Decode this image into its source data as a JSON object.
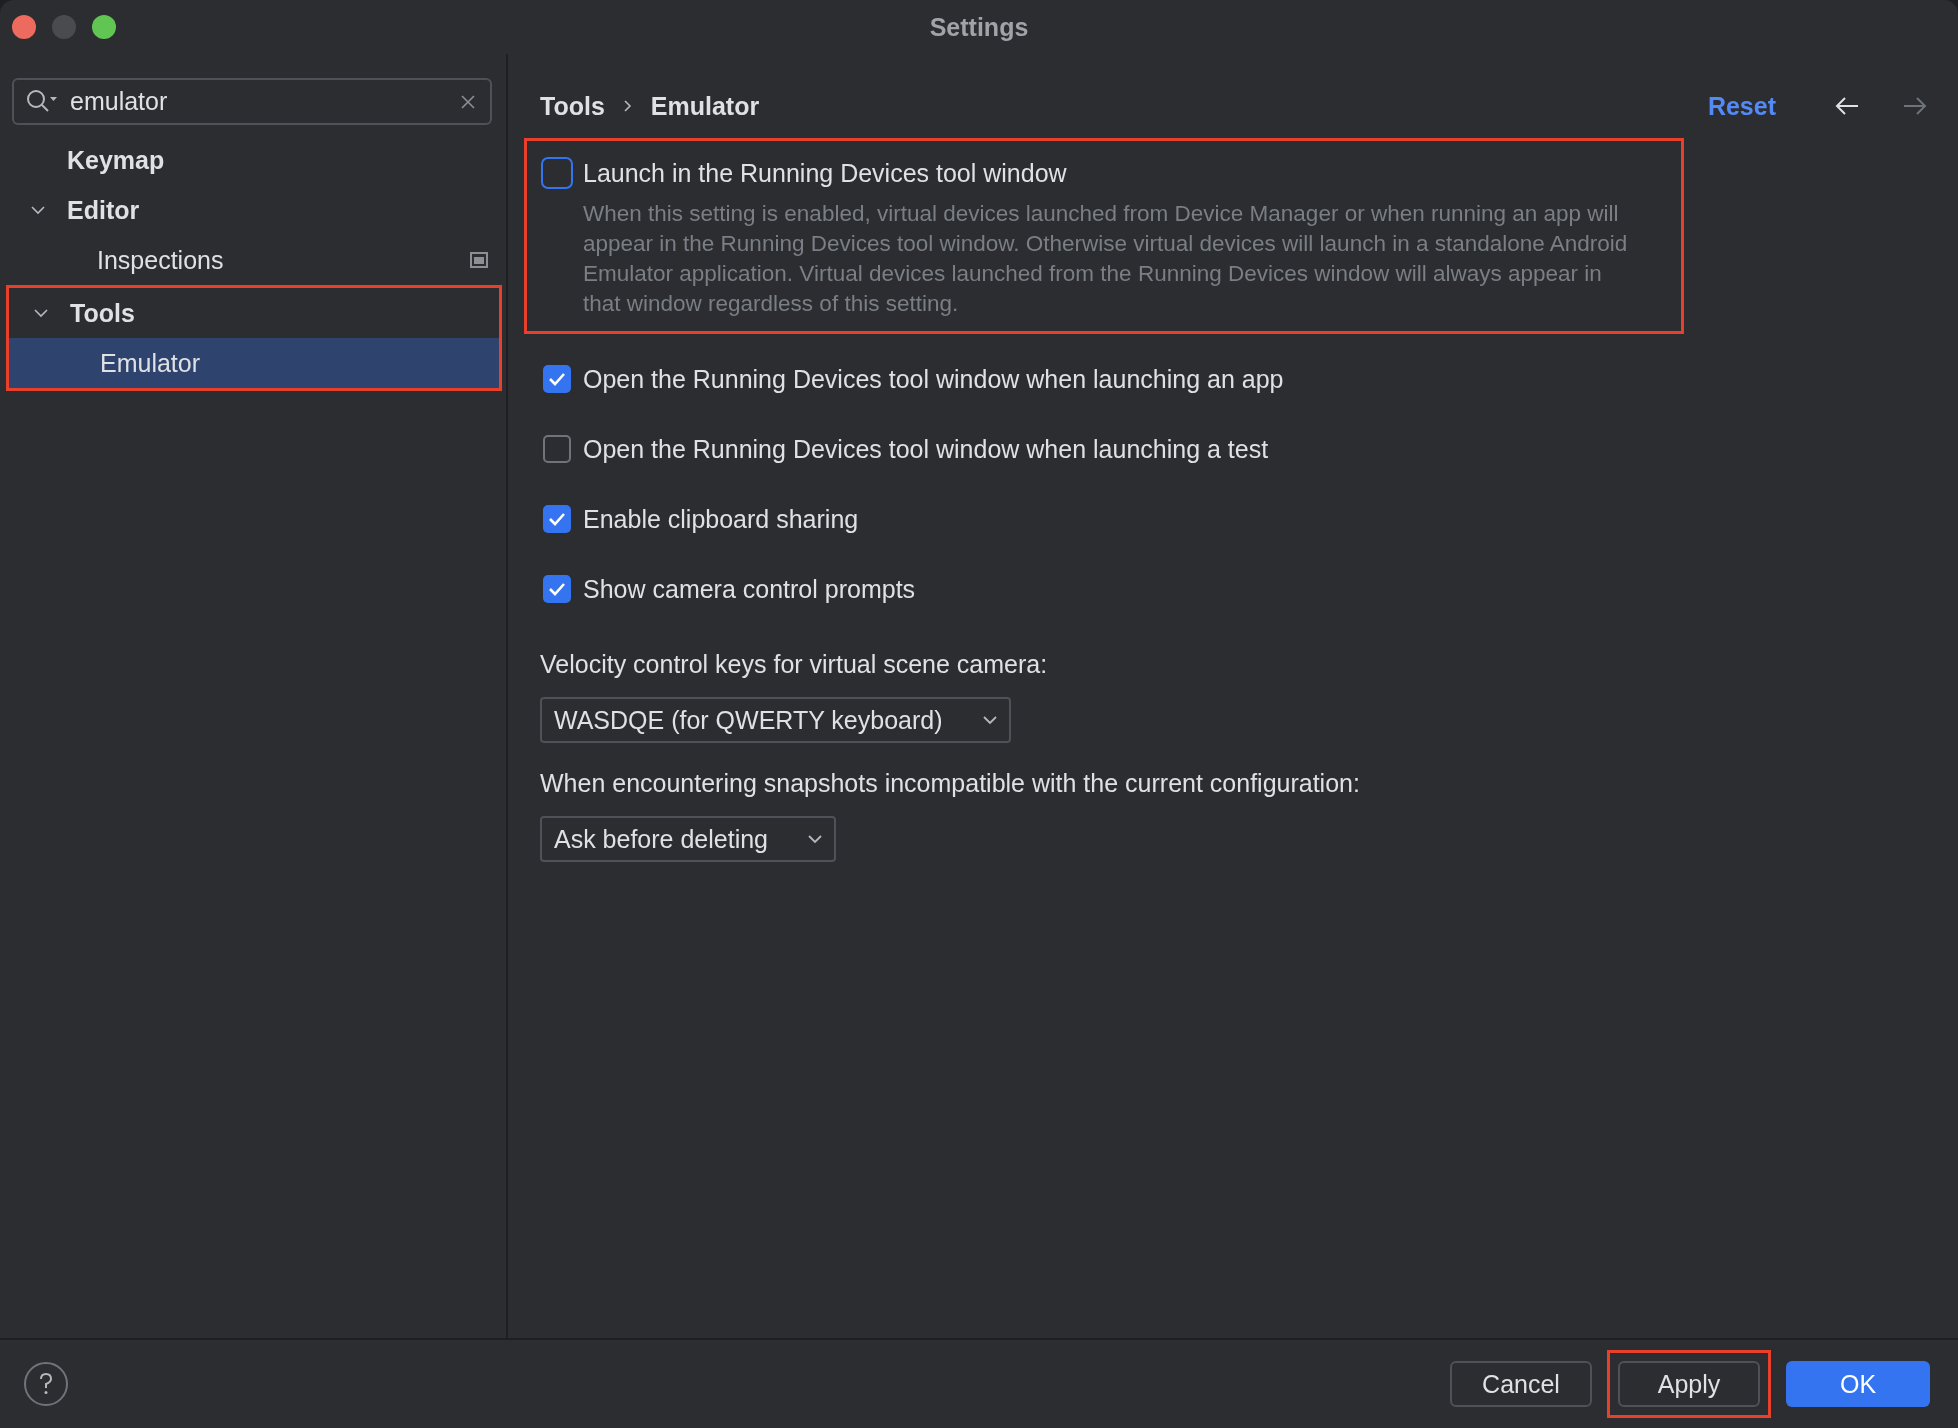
{
  "window": {
    "title": "Settings"
  },
  "search": {
    "value": "emulator"
  },
  "tree": [
    {
      "label": "Keymap",
      "selected": false,
      "highlighted": false,
      "project_scope": false
    },
    {
      "label": "Editor",
      "expanded": true,
      "selected": false,
      "highlighted": false,
      "project_scope": false,
      "children": [
        {
          "label": "Inspections",
          "selected": false,
          "project_scope": true
        }
      ]
    },
    {
      "label": "Tools",
      "expanded": true,
      "selected": false,
      "highlighted": true,
      "project_scope": false,
      "children": [
        {
          "label": "Emulator",
          "selected": true,
          "project_scope": false
        }
      ]
    }
  ],
  "breadcrumb": [
    "Tools",
    "Emulator"
  ],
  "reset": "Reset",
  "options": [
    {
      "kind": "checkbox",
      "label": "Launch in the Running Devices tool window",
      "checked": false,
      "focused": true,
      "highlighted": true,
      "description": "When this setting is enabled, virtual devices launched from Device Manager or when running an app will appear in the Running Devices tool window. Otherwise virtual devices will launch in a standalone Android Emulator application. Virtual devices launched from the Running Devices window will always appear in that window regardless of this setting."
    },
    {
      "kind": "checkbox",
      "label": "Open the Running Devices tool window when launching an app",
      "checked": true,
      "focused": false,
      "highlighted": false
    },
    {
      "kind": "checkbox",
      "label": "Open the Running Devices tool window when launching a test",
      "checked": false,
      "focused": false,
      "highlighted": false
    },
    {
      "kind": "checkbox",
      "label": "Enable clipboard sharing",
      "checked": true,
      "focused": false,
      "highlighted": false
    },
    {
      "kind": "checkbox",
      "label": "Show camera control prompts",
      "checked": true,
      "focused": false,
      "highlighted": false
    },
    {
      "kind": "dropdown",
      "label": "Velocity control keys for virtual scene camera:",
      "value": "WASDQE (for QWERTY keyboard)"
    },
    {
      "kind": "dropdown",
      "label": "When encountering snapshots incompatible with the current configuration:",
      "value": "Ask before deleting"
    }
  ],
  "buttons": [
    {
      "label": "Cancel",
      "kind": "secondary",
      "highlighted": false
    },
    {
      "label": "Apply",
      "kind": "secondary",
      "highlighted": true
    },
    {
      "label": "OK",
      "kind": "primary",
      "highlighted": false
    }
  ]
}
